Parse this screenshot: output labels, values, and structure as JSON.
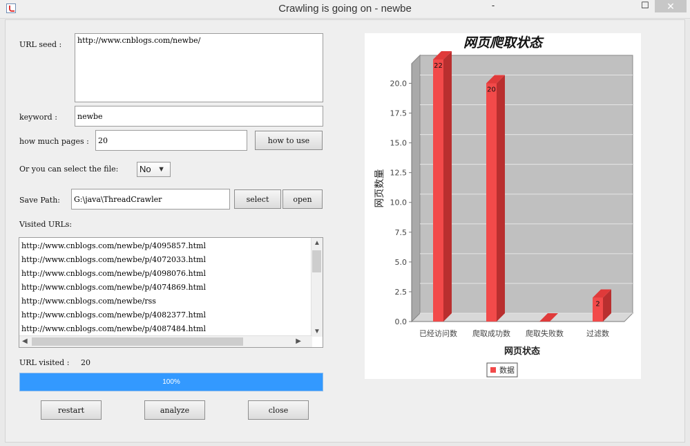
{
  "window": {
    "title": "Crawling is going on - newbe",
    "min": "-",
    "max": "☐",
    "close": "✕"
  },
  "form": {
    "url_seed_label": "URL seed :",
    "url_seed_value": "http://www.cnblogs.com/newbe/",
    "keyword_label": "keyword :",
    "keyword_value": "newbe",
    "pages_label": "how much pages :",
    "pages_value": "20",
    "how_to_use": "how to use",
    "file_label": "Or you can select the file:",
    "file_select": "No",
    "save_path_label": "Save Path:",
    "save_path_value": "G:\\java\\ThreadCrawler",
    "select_btn": "select",
    "open_btn": "open",
    "visited_label": "Visited URLs:",
    "visited_urls": [
      "http://www.cnblogs.com/newbe/p/4095857.html",
      "http://www.cnblogs.com/newbe/p/4072033.html",
      "http://www.cnblogs.com/newbe/p/4098076.html",
      "http://www.cnblogs.com/newbe/p/4074869.html",
      "http://www.cnblogs.com/newbe/rss",
      "http://www.cnblogs.com/newbe/p/4082377.html",
      "http://www.cnblogs.com/newbe/p/4087484.html"
    ],
    "url_visited_label": "URL visited :",
    "url_visited_value": "20",
    "progress_text": "100%",
    "progress_fraction": 1.0,
    "restart": "restart",
    "analyze": "analyze",
    "close": "close"
  },
  "chart_data": {
    "type": "bar",
    "title": "网页爬取状态",
    "xlabel": "网页状态",
    "ylabel": "网页数量",
    "categories": [
      "已经访问数",
      "爬取成功数",
      "爬取失败数",
      "过滤数"
    ],
    "series": [
      {
        "name": "数据",
        "values": [
          22,
          20,
          0,
          2
        ]
      }
    ],
    "value_labels": [
      "22",
      "20",
      "",
      "2"
    ],
    "ylim": [
      0,
      22
    ],
    "yticks": [
      "0.0",
      "2.5",
      "5.0",
      "7.5",
      "10.0",
      "12.5",
      "15.0",
      "17.5",
      "20.0"
    ],
    "ytick_values": [
      0,
      2.5,
      5,
      7.5,
      10,
      12.5,
      15,
      17.5,
      20
    ],
    "grid": true,
    "legend": "bottom",
    "bar_color": "#f24a4a",
    "bar_side_color": "#b92f2f",
    "plot_bg": "#c0c0c0"
  }
}
